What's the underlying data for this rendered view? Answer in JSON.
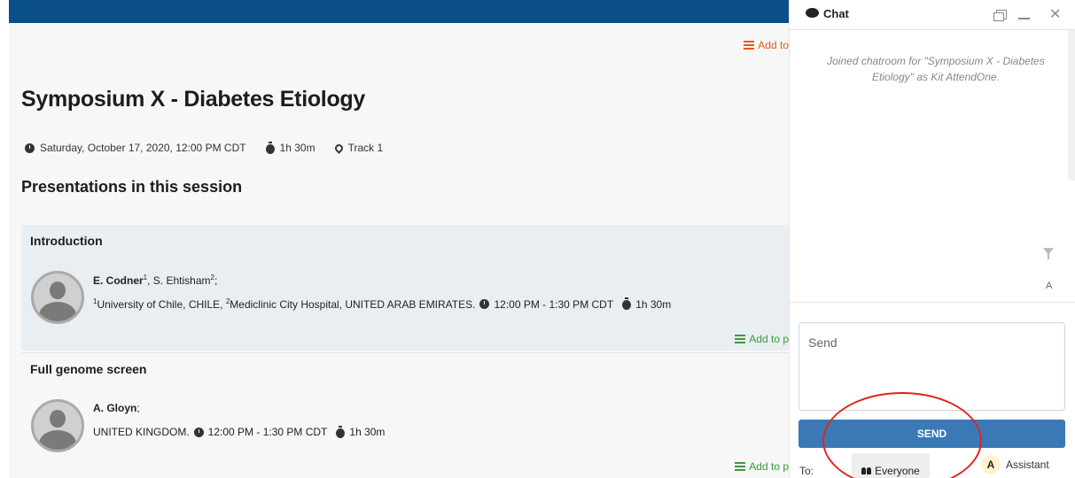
{
  "colors": {
    "topbar": "#0b4f8a",
    "accent_orange": "#e05d16",
    "accent_green": "#3a9b3a",
    "send_button": "#3a79b6",
    "annotation": "#e0231f"
  },
  "header": {
    "add_to_label": "Add to"
  },
  "session": {
    "title": "Symposium X - Diabetes Etiology",
    "date": "Saturday, October 17, 2020, 12:00 PM CDT",
    "duration": "1h 30m",
    "location": "Track 1"
  },
  "presentations_heading": "Presentations in this session",
  "presentations": [
    {
      "title": "Introduction",
      "author1": "E. Codner",
      "author1_sup": "1",
      "author2": ", S. Ehtisham",
      "author2_sup": "2",
      "author_end": ";",
      "affil1_sup": "1",
      "affil1": "University of Chile, CHILE, ",
      "affil2_sup": "2",
      "affil2": "Mediclinic City Hospital, UNITED ARAB EMIRATES.",
      "time": "12:00 PM - 1:30 PM CDT",
      "duration": "1h 30m",
      "add_label": "Add to p"
    },
    {
      "title": "Full genome screen",
      "author1": "A. Gloyn",
      "author_end": ";",
      "affil": "UNITED KINGDOM.",
      "time": "12:00 PM - 1:30 PM CDT",
      "duration": "1h 30m",
      "add_label": "Add to p"
    }
  ],
  "chat": {
    "title": "Chat",
    "system_message": "Joined chatroom for \"Symposium X - Diabetes Etiology\" as Kit AttendOne.",
    "font_toggle": "A",
    "input_placeholder": "Send",
    "send_label": "SEND",
    "to_label": "To:",
    "everyone_label": "Everyone",
    "assistant_badge": "A",
    "assistant_label": "Assistant"
  }
}
